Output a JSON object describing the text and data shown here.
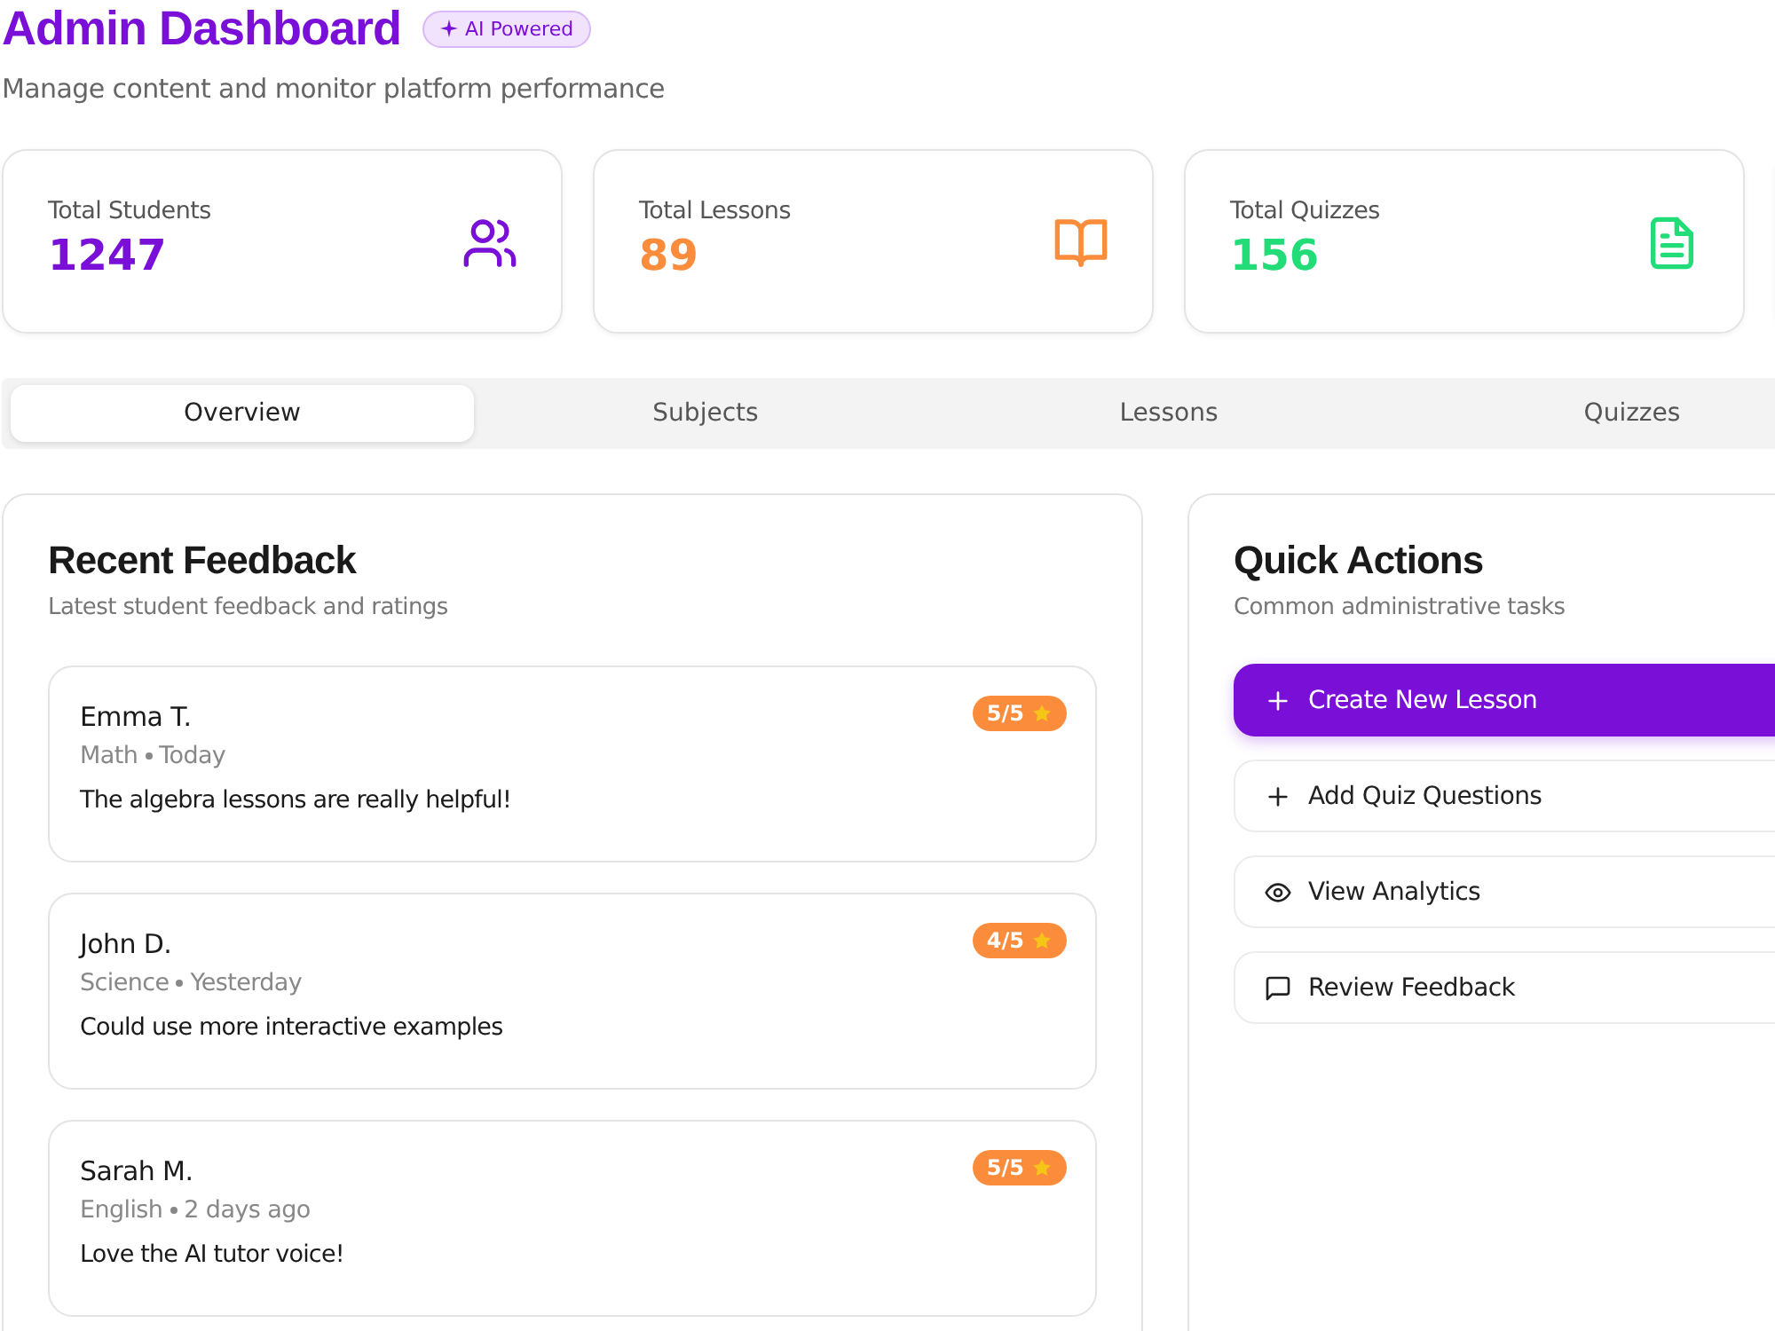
{
  "header": {
    "title": "Admin Dashboard",
    "badge": "AI Powered",
    "subtitle": "Manage content and monitor platform performance"
  },
  "stats": [
    {
      "label": "Total Students",
      "value": "1247",
      "color": "#7a10d8",
      "kind": "users"
    },
    {
      "label": "Total Lessons",
      "value": "89",
      "color": "#fb8c3c",
      "kind": "book"
    },
    {
      "label": "Total Quizzes",
      "value": "156",
      "color": "#22dd77",
      "kind": "document"
    }
  ],
  "tabs": [
    {
      "label": "Overview",
      "selected": true
    },
    {
      "label": "Subjects",
      "selected": false
    },
    {
      "label": "Lessons",
      "selected": false
    },
    {
      "label": "Quizzes",
      "selected": false
    }
  ],
  "feedback": {
    "title": "Recent Feedback",
    "subtitle": "Latest student feedback and ratings",
    "items": [
      {
        "name": "Emma T.",
        "subject": "Math",
        "when": "Today",
        "comment": "The algebra lessons are really helpful!",
        "rating": "5/5"
      },
      {
        "name": "John D.",
        "subject": "Science",
        "when": "Yesterday",
        "comment": "Could use more interactive examples",
        "rating": "4/5"
      },
      {
        "name": "Sarah M.",
        "subject": "English",
        "when": "2 days ago",
        "comment": "Love the AI tutor voice!",
        "rating": "5/5"
      }
    ]
  },
  "quick_actions": {
    "title": "Quick Actions",
    "subtitle": "Common administrative tasks",
    "actions": [
      {
        "label": "Create New Lesson",
        "kind": "plus",
        "primary": true
      },
      {
        "label": "Add Quiz Questions",
        "kind": "plus",
        "primary": false
      },
      {
        "label": "View Analytics",
        "kind": "eye",
        "primary": false
      },
      {
        "label": "Review Feedback",
        "kind": "message",
        "primary": false
      }
    ]
  }
}
